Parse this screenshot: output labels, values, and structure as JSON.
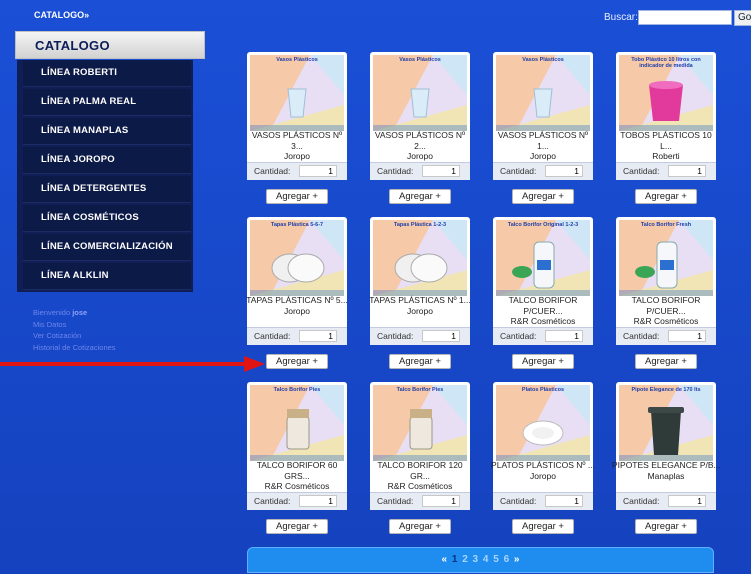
{
  "top": {
    "crumb": "CATALOGO»",
    "search_label": "Buscar:",
    "search_value": "",
    "go_label": "Go"
  },
  "sidebar": {
    "header": "CATALOGO",
    "items": [
      "LÍNEA ROBERTI",
      "LÍNEA PALMA REAL",
      "LÍNEA MANAPLAS",
      "LÍNEA JOROPO",
      "LÍNEA DETERGENTES",
      "LÍNEA COSMÉTICOS",
      "LÍNEA COMERCIALIZACIÓN",
      "LÍNEA ALKLIN"
    ]
  },
  "user": {
    "welcome": "Bienvenido",
    "name": "jose",
    "links": [
      "Mis Datos",
      "Ver Cotización",
      "Historial de Cotizaciones"
    ]
  },
  "qty_label": "Cantidad:",
  "add_label": "Agregar +",
  "products": [
    {
      "thumb_title": "Vasos Plásticos",
      "name": "VASOS PLÁSTICOS Nº",
      "name2": "3...",
      "brand": "Joropo",
      "qty": "1"
    },
    {
      "thumb_title": "Vasos Plásticos",
      "name": "VASOS PLÁSTICOS Nº",
      "name2": "2...",
      "brand": "Joropo",
      "qty": "1"
    },
    {
      "thumb_title": "Vasos Plásticos",
      "name": "VASOS PLÁSTICOS Nº",
      "name2": "1...",
      "brand": "Joropo",
      "qty": "1"
    },
    {
      "thumb_title": "Tobo Plástico 10 litros con indicador de medida",
      "name": "TOBOS PLÁSTICOS 10",
      "name2": "L...",
      "brand": "Roberti",
      "qty": "1"
    },
    {
      "thumb_title": "Tapas Plástica 5-6-7",
      "name": "TAPAS PLÁSTICAS Nº 5...",
      "name2": "",
      "brand": "Joropo",
      "qty": "1"
    },
    {
      "thumb_title": "Tapas Plástica 1-2-3",
      "name": "TAPAS PLÁSTICAS Nº 1...",
      "name2": "",
      "brand": "Joropo",
      "qty": "1"
    },
    {
      "thumb_title": "Talco Borifor Original 1-2-3",
      "name": "TALCO BORIFOR",
      "name2": "P/CUER...",
      "brand": "R&R Cosméticos",
      "qty": "1"
    },
    {
      "thumb_title": "Talco Borifor Fresh",
      "name": "TALCO BORIFOR",
      "name2": "P/CUER...",
      "brand": "R&R Cosméticos",
      "qty": "1"
    },
    {
      "thumb_title": "Talco Borifor Pies",
      "name": "TALCO BORIFOR 60",
      "name2": "GRS...",
      "brand": "R&R Cosméticos",
      "qty": "1"
    },
    {
      "thumb_title": "Talco Borifor Pies",
      "name": "TALCO BORIFOR 120",
      "name2": "GR...",
      "brand": "R&R Cosméticos",
      "qty": "1"
    },
    {
      "thumb_title": "Platos Plásticos",
      "name": "PLATOS PLÁSTICOS Nº ...",
      "name2": "",
      "brand": "Joropo",
      "qty": "1"
    },
    {
      "thumb_title": "Pipote Elegance de 170 lts",
      "name": "PIPOTES ELEGANCE P/B...",
      "name2": "",
      "brand": "Manaplas",
      "qty": "1"
    }
  ],
  "pager": {
    "prev": "«",
    "pages": [
      "1",
      "2",
      "3",
      "4",
      "5",
      "6"
    ],
    "current": "1",
    "next": "»"
  }
}
